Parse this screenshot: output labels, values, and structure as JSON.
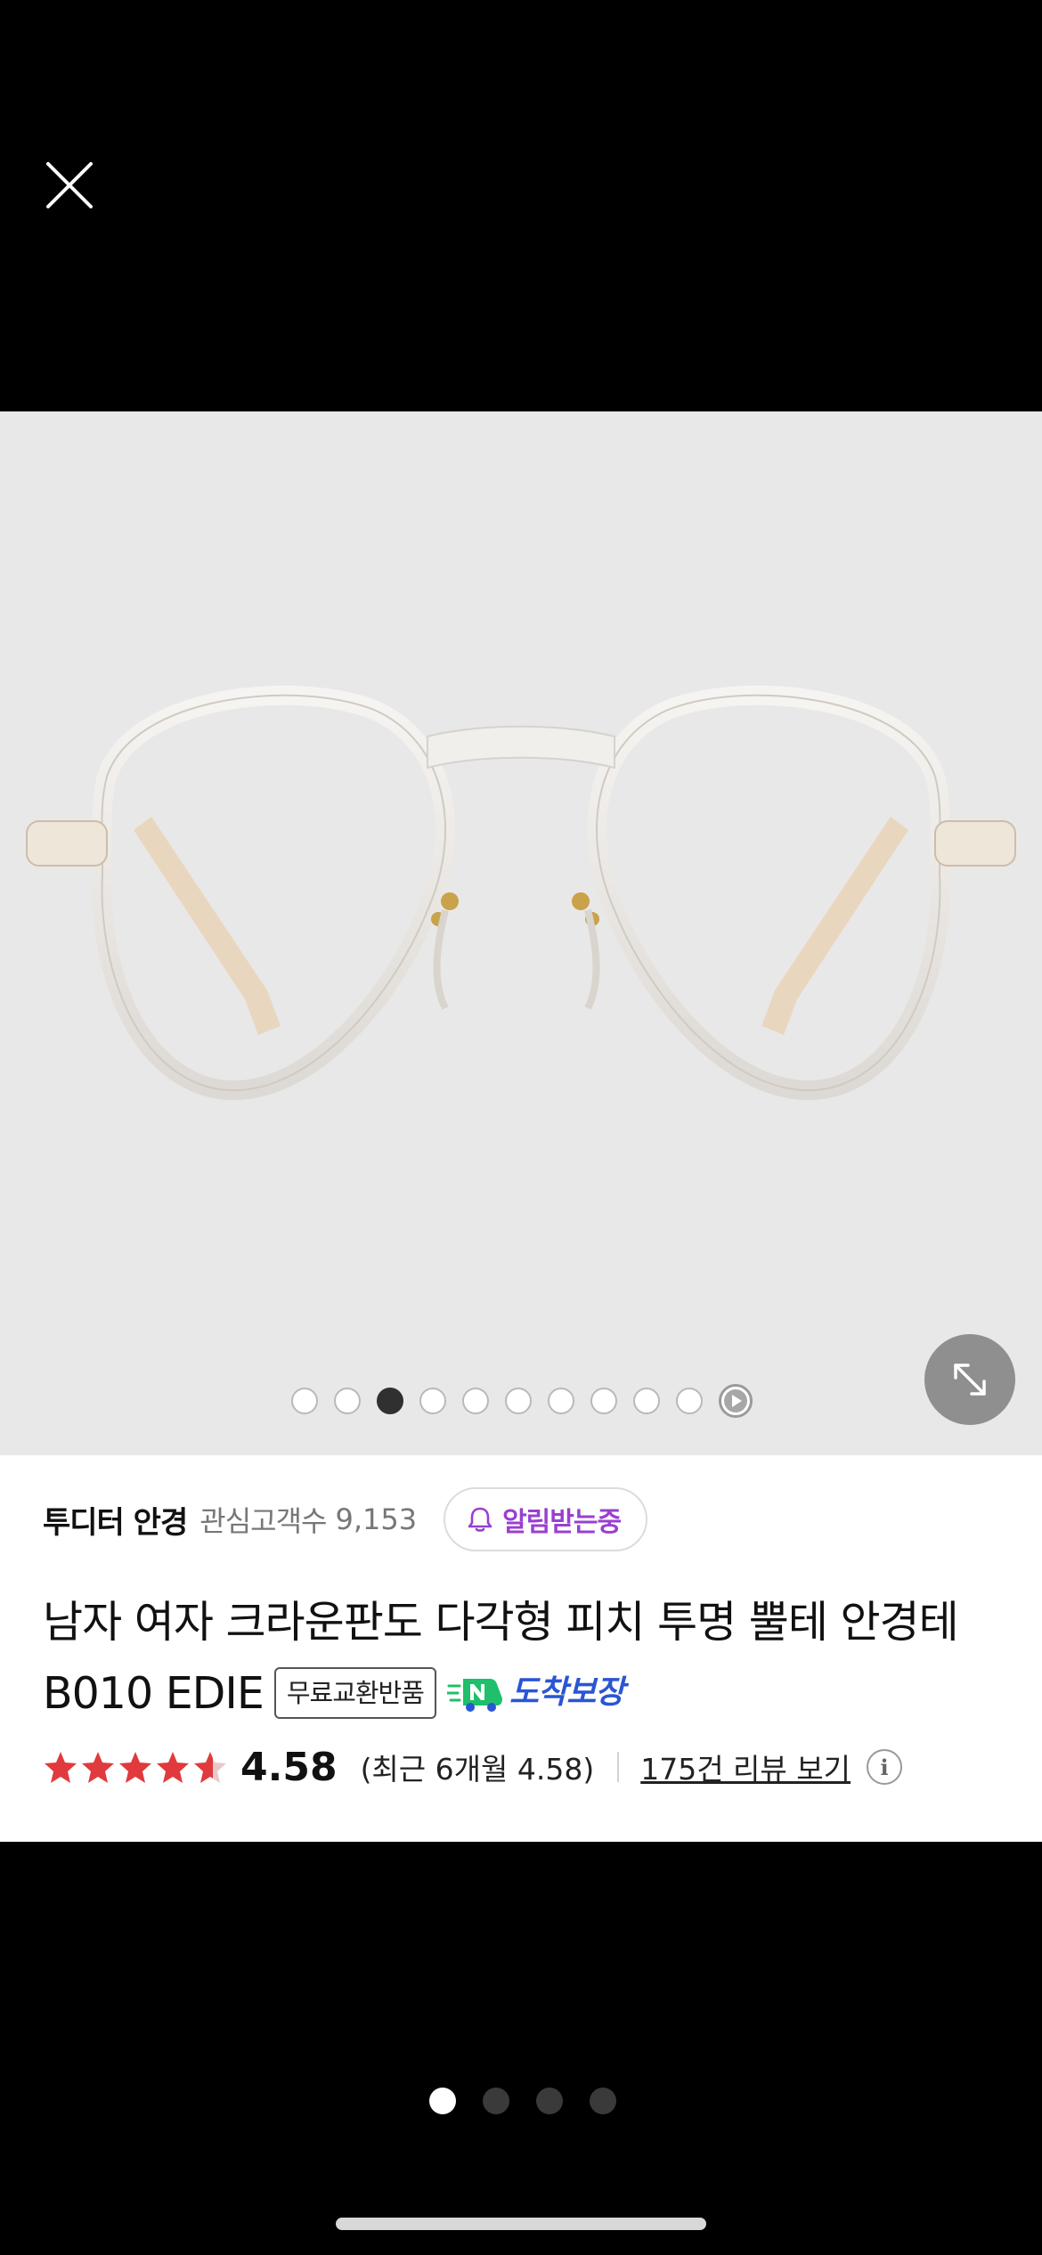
{
  "viewer": {
    "close_icon": "close-icon",
    "expand_icon": "expand-diagonal-icon",
    "image_dots_total": 10,
    "image_dots_active_index": 2
  },
  "product": {
    "brand_name": "투디터 안경",
    "favorite_label": "관심고객수",
    "favorite_count": "9,153",
    "notify_label": "알림받는중",
    "title": "남자 여자 크라운판도 다각형 피치 투명 뿔테 안경테 B010 EDIE",
    "tag_label": "무료교환반품",
    "delivery_label": "도착보장",
    "rating_value": "4.58",
    "rating_stars": 4.58,
    "recent_rating": "(최근 6개월 4.58)",
    "reviews_link": "175건 리뷰 보기",
    "info_icon_label": "i"
  },
  "pager": {
    "total": 4,
    "active_index": 0
  },
  "colors": {
    "star": "#e03a3e",
    "notify_purple": "#9a3fd0",
    "delivery_blue": "#2a55d3",
    "delivery_green": "#1fbf6b",
    "photo_bg": "#e9e8e8"
  }
}
